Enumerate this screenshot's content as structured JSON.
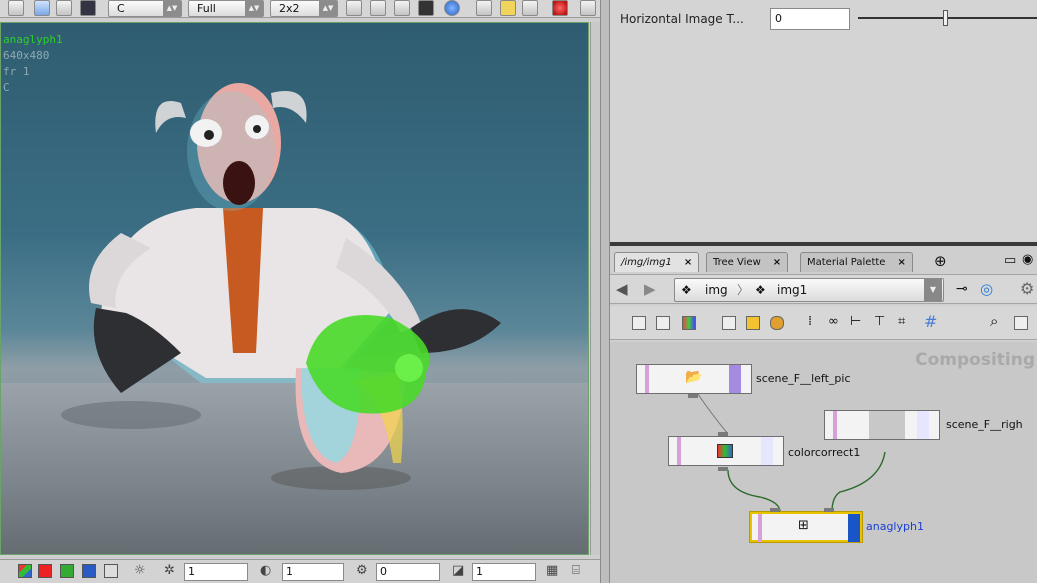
{
  "viewer": {
    "toolbar": {
      "plane": "C",
      "resolution": "Full",
      "sampling": "2x2"
    },
    "overlay": {
      "node_name": "anaglyph1",
      "size": "640x480",
      "frame": "fr 1",
      "plane": "C"
    },
    "bottom": {
      "field1": "1",
      "field2": "1",
      "field3": "0",
      "field4": "1"
    }
  },
  "parameters": {
    "label": "Horizontal Image T...",
    "value": "0",
    "slider_fraction": 0.5
  },
  "network": {
    "tabs": [
      {
        "label": "/img/img1",
        "close": "×"
      },
      {
        "label": "Tree View",
        "close": "×"
      },
      {
        "label": "Material Palette",
        "close": "×"
      }
    ],
    "path": {
      "level1": "img",
      "level2": "img1"
    },
    "context_label": "Compositing",
    "nodes": {
      "left_pic": "scene_F__left_pic",
      "right_pic": "scene_F__righ",
      "colorcorrect": "colorcorrect1",
      "anaglyph": "anaglyph1"
    }
  },
  "colors": {
    "selected_node": "#e8c400",
    "display_flag": "#1a55c8",
    "viewer_label": "#2bd12b"
  }
}
